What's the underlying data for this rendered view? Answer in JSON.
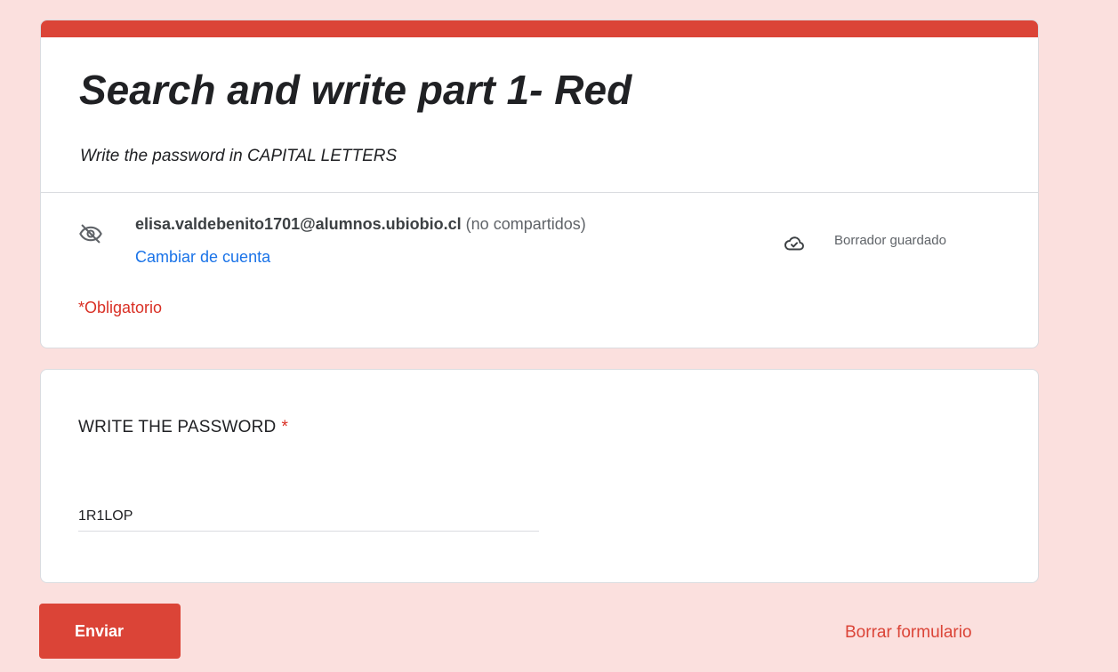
{
  "theme": {
    "accent_color": "#db4437",
    "background_color": "#fbe0de",
    "link_color": "#1a73e8",
    "required_color": "#d93025"
  },
  "header": {
    "title": "Search and write part 1- Red",
    "description": "Write the password in CAPITAL LETTERS"
  },
  "account": {
    "not_shared_icon": "eye-off-icon",
    "email": "elisa.valdebenito1701@alumnos.ubiobio.cl",
    "shared_status": "(no compartidos)",
    "switch_label": "Cambiar de cuenta",
    "save_icon": "cloud-check-icon",
    "save_status": "Borrador guardado"
  },
  "required_note": "*Obligatorio",
  "question": {
    "title": "WRITE THE PASSWORD",
    "required_marker": "*",
    "answer_value": "1R1LOP"
  },
  "actions": {
    "submit_label": "Enviar",
    "clear_label": "Borrar formulario"
  }
}
